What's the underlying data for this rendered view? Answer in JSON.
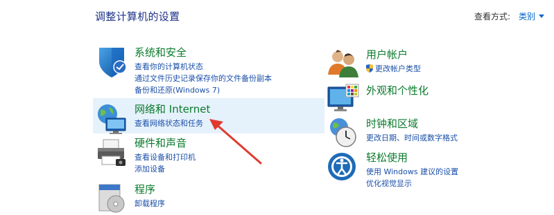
{
  "page_title": "调整计算机的设置",
  "view_by": {
    "label": "查看方式:",
    "value": "类别"
  },
  "categories_left": [
    {
      "title": "系统和安全",
      "icon": "shield-icon",
      "links": [
        "查看你的计算机状态",
        "通过文件历史记录保存你的文件备份副本",
        "备份和还原(Windows 7)"
      ]
    },
    {
      "title": "网络和 Internet",
      "icon": "network-globe-icon",
      "links": [
        "查看网络状态和任务"
      ]
    },
    {
      "title": "硬件和声音",
      "icon": "printer-icon",
      "links": [
        "查看设备和打印机",
        "添加设备"
      ]
    },
    {
      "title": "程序",
      "icon": "programs-disc-icon",
      "links": [
        "卸载程序"
      ]
    }
  ],
  "categories_right": [
    {
      "title": "用户帐户",
      "icon": "users-icon",
      "links": [
        "更改帐户类型"
      ]
    },
    {
      "title": "外观和个性化",
      "icon": "monitor-palette-icon",
      "links": []
    },
    {
      "title": "时钟和区域",
      "icon": "clock-globe-icon",
      "links": [
        "更改日期、时间或数字格式"
      ]
    },
    {
      "title": "轻松使用",
      "icon": "ease-of-access-icon",
      "links": [
        "使用 Windows 建议的设置",
        "优化视觉显示"
      ]
    }
  ],
  "colors": {
    "title_blue": "#1e3287",
    "category_green": "#0a7a2c",
    "link_blue": "#1a4fa8",
    "highlight": "#e5f1fb",
    "arrow_red": "#e03a2f"
  }
}
